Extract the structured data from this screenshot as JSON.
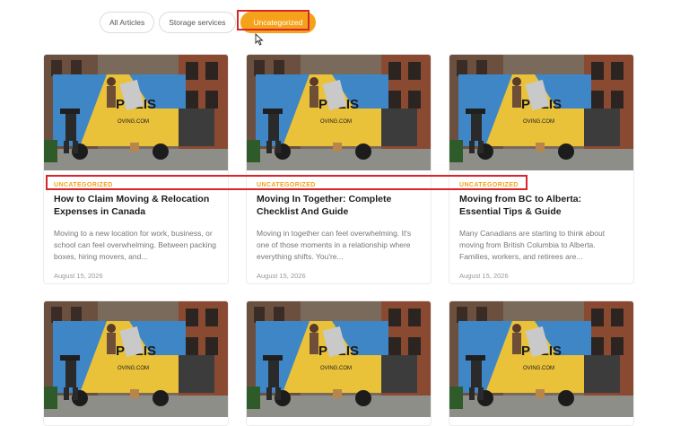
{
  "filters": [
    {
      "label": "All Articles",
      "active": false
    },
    {
      "label": "Storage services",
      "active": false
    },
    {
      "label": "Uncategorized",
      "active": true
    }
  ],
  "thumbnail": {
    "truck_text": "POLIS",
    "truck_url": "OVING.COM"
  },
  "posts": [
    {
      "category": "UNCATEGORIZED",
      "title": "How to Claim Moving & Relocation Expenses in Canada",
      "excerpt": "Moving to a new location for work, business, or school can feel overwhelming. Between packing boxes, hiring movers, and...",
      "date": "August 15, 2026"
    },
    {
      "category": "UNCATEGORIZED",
      "title": "Moving In Together: Complete Checklist And Guide",
      "excerpt": "Moving in together can feel overwhelming. It's one of those moments in a relationship where everything shifts. You're...",
      "date": "August 15, 2026"
    },
    {
      "category": "UNCATEGORIZED",
      "title": "Moving from BC to Alberta: Essential Tips & Guide",
      "excerpt": "Many Canadians are starting to think about moving from British Columbia to Alberta. Families, workers, and retirees are...",
      "date": "August 15, 2026"
    }
  ],
  "colors": {
    "accent": "#f5a21b",
    "highlight": "#d9262c"
  }
}
